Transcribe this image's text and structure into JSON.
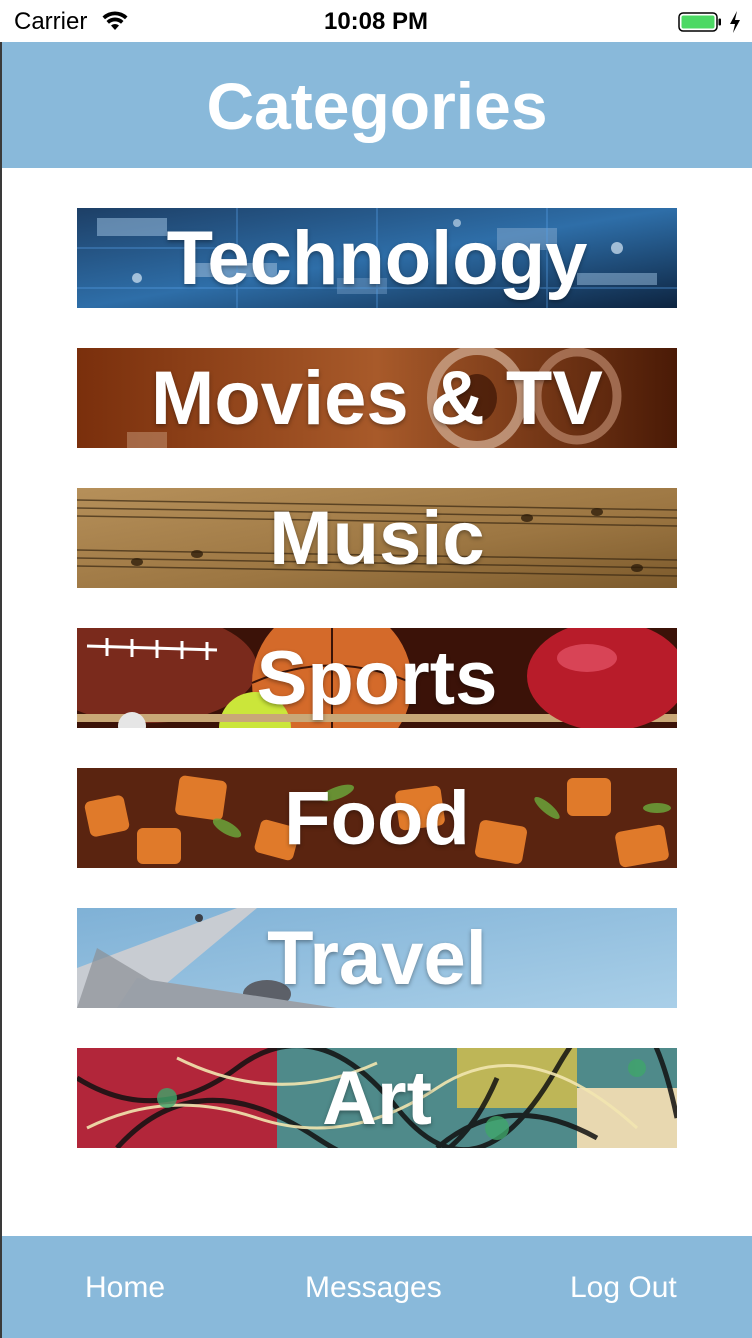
{
  "status_bar": {
    "carrier": "Carrier",
    "time": "10:08 PM",
    "wifi_icon": "wifi-icon",
    "battery_icon": "battery-full-icon",
    "charging_icon": "charging-bolt-icon",
    "battery_color": "#4cd964"
  },
  "header": {
    "title": "Categories",
    "background": "#89b9da"
  },
  "categories": [
    {
      "label": "Technology"
    },
    {
      "label": "Movies & TV"
    },
    {
      "label": "Music"
    },
    {
      "label": "Sports"
    },
    {
      "label": "Food"
    },
    {
      "label": "Travel"
    },
    {
      "label": "Art"
    }
  ],
  "tab_bar": {
    "home": "Home",
    "messages": "Messages",
    "logout": "Log Out",
    "background": "#89b9da"
  }
}
